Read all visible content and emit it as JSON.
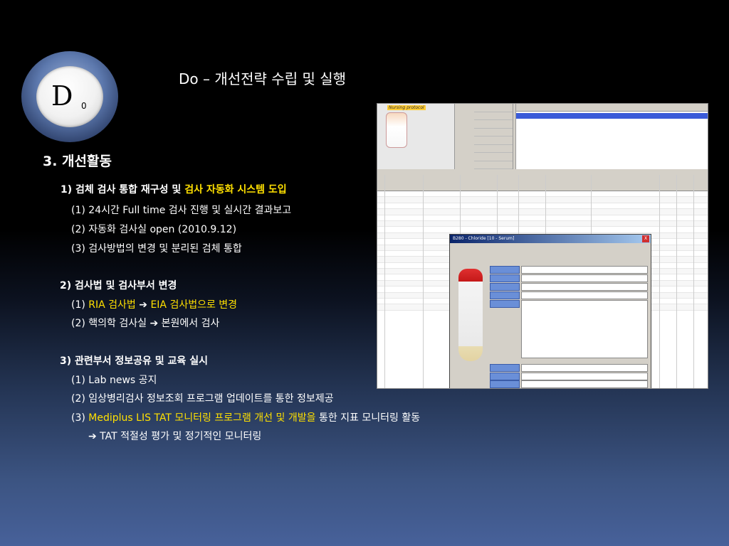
{
  "badge": {
    "letter": "D",
    "sub": "0"
  },
  "title": "Do – 개선전략 수립 및 실행",
  "section": "3. 개선활동",
  "items": {
    "h1": {
      "prefix": "1) 검체 검사 통합 재구성 및 ",
      "highlight": "검사 자동화 시스템 도입"
    },
    "h1_1": "(1) 24시간 Full time 검사 진행 및 실시간 결과보고",
    "h1_2": "(2) 자동화 검사실 open (2010.9.12)",
    "h1_3": "(3) 검사방법의 변경 및 분리된 검체 통합",
    "h2": "2) 검사법 및 검사부서 변경",
    "h2_1": {
      "prefix": "(1) ",
      "a": "RIA 검사법",
      "arrow": "➔",
      "b": "EIA 검사법으로 변경"
    },
    "h2_2": "(2) 핵의학 검사실 ➔ 본원에서 검사",
    "h3": "3) 관련부서 정보공유 및 교육 실시",
    "h3_1": "(1) Lab news 공지",
    "h3_2": "(2) 임상병리검사 정보조회 프로그램 업데이트를 통한 정보제공",
    "h3_3": {
      "prefix": "(3) ",
      "highlight": "Mediplus  LIS TAT 모니터링 프로그램 개선 및 개발을",
      "suffix": " 통한 지표 모니터링 활동"
    },
    "h3_4": "➔ TAT 적절성 평가 및 정기적인 모니터링"
  },
  "screenshot": {
    "nursing_label": "Nursing protocol",
    "dialog_title": "B280 - Chloride [10 - Serum]",
    "dialog_close": "X"
  },
  "colors": {
    "highlight": "#ffe000",
    "background_bottom": "#47619a"
  }
}
